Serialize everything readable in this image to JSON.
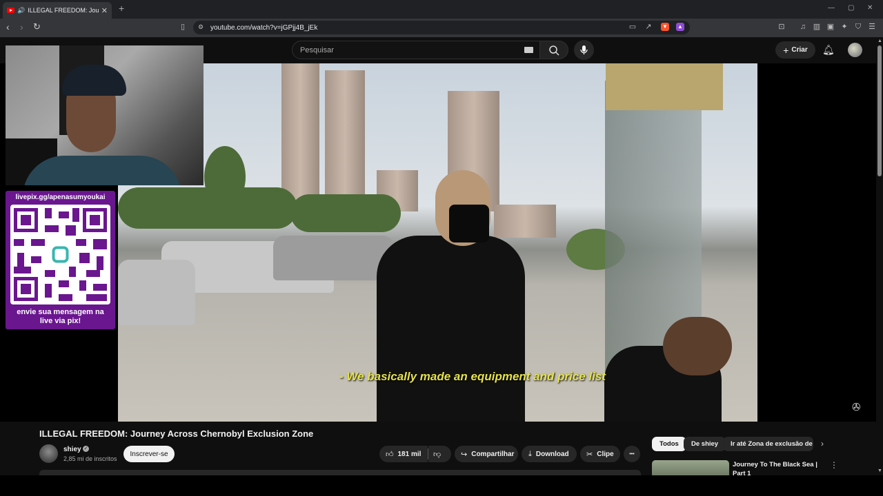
{
  "browser": {
    "tab_title": "ILLEGAL FREEDOM: Journey Across Chernobyl Exclusion Zone",
    "url": "youtube.com/watch?v=jGPjj4B_jEk",
    "new_tab": "+",
    "close": "✕",
    "minimize": "—",
    "maximize": "▢",
    "window_close": "✕"
  },
  "youtube": {
    "search_placeholder": "Pesquisar",
    "create_label": "Criar"
  },
  "video": {
    "subtitle": "- We basically made an equipment and price list",
    "title": "ILLEGAL FREEDOM: Journey Across Chernobyl Exclusion Zone"
  },
  "overlay": {
    "pix_url": "livepix.gg/apenasumyoukai",
    "pix_message_line1": "envie sua mensagem na",
    "pix_message_line2": "live via pix!"
  },
  "channel": {
    "name": "shiey",
    "subscribers": "2,85 mi de inscritos",
    "subscribe_label": "Inscrever-se"
  },
  "actions": {
    "likes": "181 mil",
    "share": "Compartilhar",
    "download": "Download",
    "clip": "Clipe",
    "more": "•••"
  },
  "chips": {
    "all": "Todos",
    "from_channel": "De shiey",
    "go_to": "Ir até Zona de exclusão de Ch"
  },
  "next_video": {
    "title": "Journey To The Black Sea | Part 1"
  },
  "icons": {
    "back": "back-arrow-icon",
    "forward": "forward-arrow-icon",
    "reload": "reload-icon",
    "bookmark": "bookmark-icon",
    "brave": "brave-shield-icon"
  }
}
